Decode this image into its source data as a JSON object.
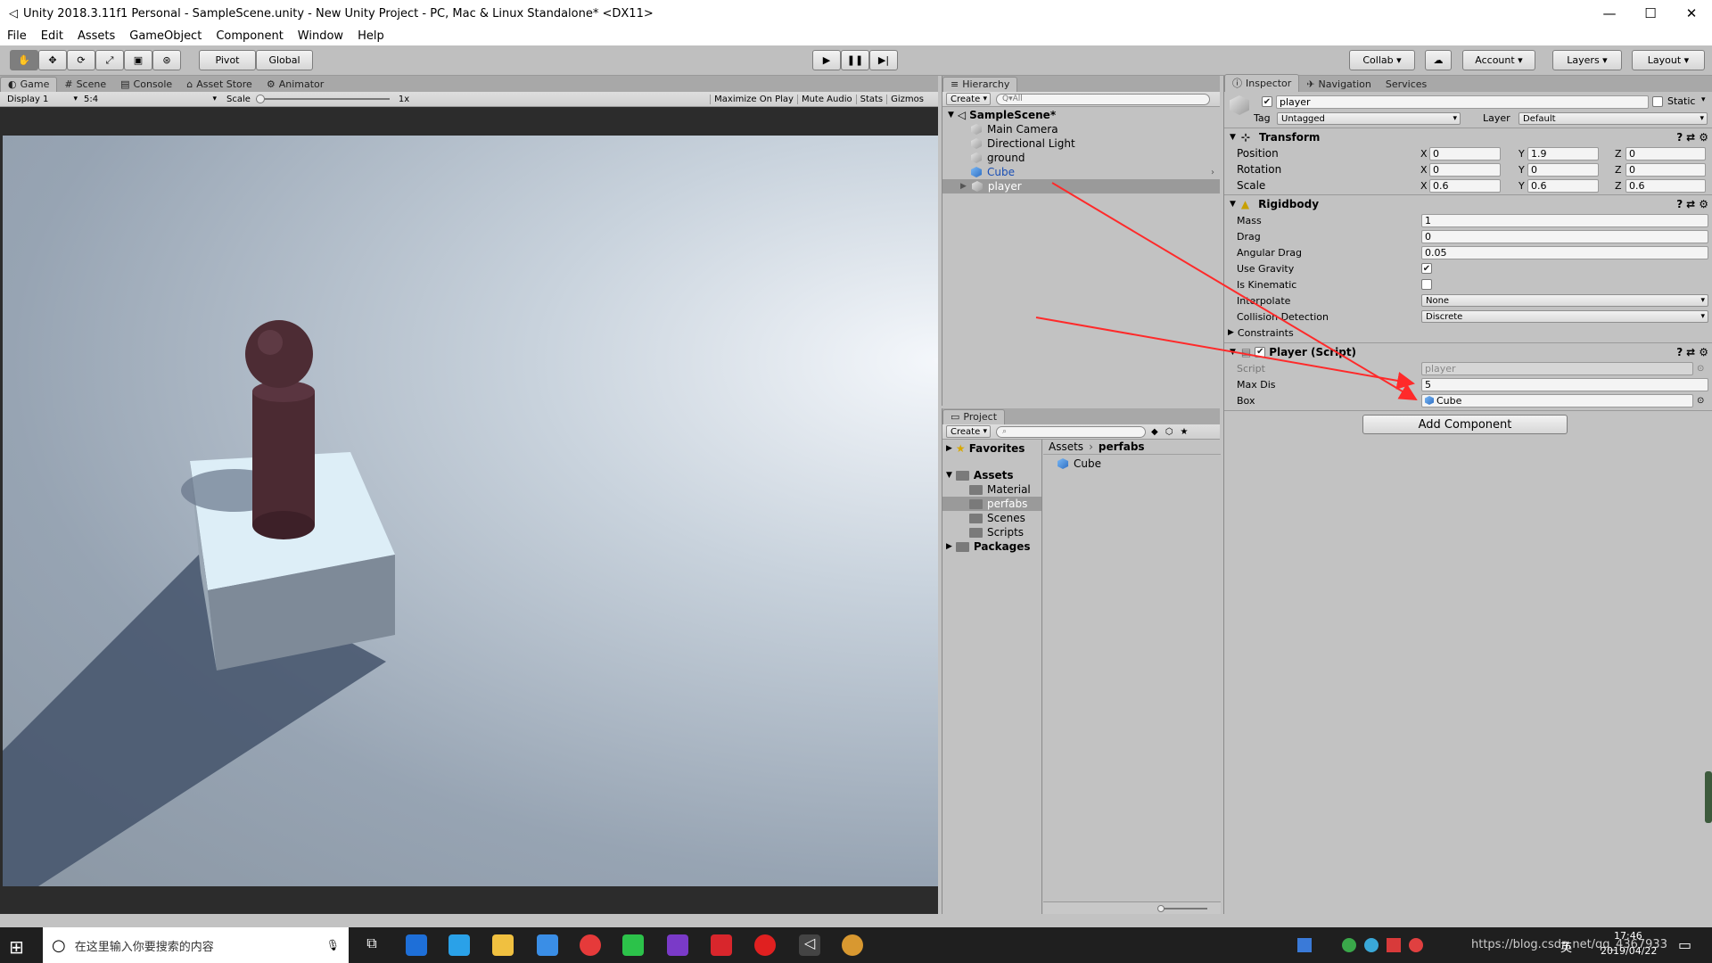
{
  "window": {
    "title": "Unity 2018.3.11f1 Personal - SampleScene.unity - New Unity Project - PC, Mac & Linux Standalone* <DX11>"
  },
  "menu": [
    "File",
    "Edit",
    "Assets",
    "GameObject",
    "Component",
    "Window",
    "Help"
  ],
  "toolbar": {
    "pivot": "Pivot",
    "global": "Global",
    "collab": "Collab",
    "account": "Account",
    "layers": "Layers",
    "layout": "Layout"
  },
  "game_tabs": [
    "Game",
    "Scene",
    "Console",
    "Asset Store",
    "Animator"
  ],
  "game_bar": {
    "display": "Display 1",
    "aspect": "5:4",
    "scale_label": "Scale",
    "scale_value": "1x",
    "maximize": "Maximize On Play",
    "mute": "Mute Audio",
    "stats": "Stats",
    "gizmos": "Gizmos"
  },
  "hierarchy": {
    "tab": "Hierarchy",
    "create": "Create",
    "search_placeholder": "Q▾All",
    "scene": "SampleScene*",
    "items": [
      "Main Camera",
      "Directional Light",
      "ground",
      "Cube",
      "player"
    ]
  },
  "project": {
    "tab": "Project",
    "create": "Create",
    "favorites": "Favorites",
    "assets": "Assets",
    "folders": [
      "Material",
      "perfabs",
      "Scenes",
      "Scripts"
    ],
    "packages": "Packages",
    "breadcrumb": [
      "Assets",
      "perfabs"
    ],
    "files": [
      "Cube"
    ]
  },
  "inspector": {
    "tabs": [
      "Inspector",
      "Navigation",
      "Services"
    ],
    "object_name": "player",
    "static_label": "Static",
    "tag_label": "Tag",
    "tag_value": "Untagged",
    "layer_label": "Layer",
    "layer_value": "Default",
    "transform": {
      "title": "Transform",
      "rows": [
        {
          "label": "Position",
          "x": "0",
          "y": "1.9",
          "z": "0"
        },
        {
          "label": "Rotation",
          "x": "0",
          "y": "0",
          "z": "0"
        },
        {
          "label": "Scale",
          "x": "0.6",
          "y": "0.6",
          "z": "0.6"
        }
      ]
    },
    "rigidbody": {
      "title": "Rigidbody",
      "mass_label": "Mass",
      "mass": "1",
      "drag_label": "Drag",
      "drag": "0",
      "angular_label": "Angular Drag",
      "angular": "0.05",
      "gravity_label": "Use Gravity",
      "kinematic_label": "Is Kinematic",
      "interpolate_label": "Interpolate",
      "interpolate": "None",
      "collision_label": "Collision Detection",
      "collision": "Discrete",
      "constraints_label": "Constraints"
    },
    "script": {
      "title": "Player (Script)",
      "script_label": "Script",
      "script_value": "player",
      "maxdis_label": "Max Dis",
      "maxdis": "5",
      "box_label": "Box",
      "box": "Cube"
    },
    "add_component": "Add Component"
  },
  "taskbar": {
    "search_placeholder": "在这里输入你要搜索的内容",
    "watermark": "https://blog.csdn.net/qq_4367933",
    "time": "17:46",
    "date": "2019/04/22",
    "ime": "英"
  },
  "colors": {
    "arrow": "#ff2a2a",
    "selection": "#9fb9d9",
    "panel": "#c2c2c2"
  }
}
